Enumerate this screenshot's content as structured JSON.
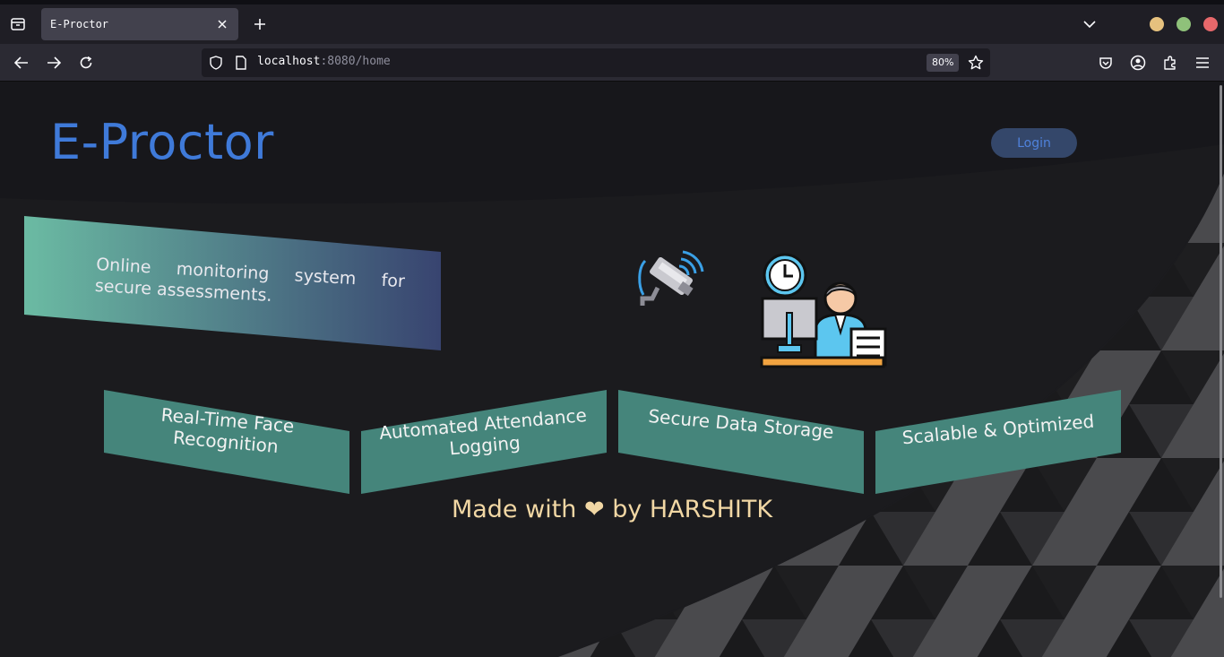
{
  "browser": {
    "tab_title": "E-Proctor",
    "url_host": "localhost",
    "url_rest": ":8080/home",
    "zoom": "80%"
  },
  "page": {
    "brand": "E-Proctor",
    "login_label": "Login",
    "tagline": "Online monitoring system for secure assessments.",
    "features": [
      {
        "label": "Real-Time Face Recognition"
      },
      {
        "label": "Automated Attendance Logging"
      },
      {
        "label": "Secure Data Storage"
      },
      {
        "label": "Scalable & Optimized"
      }
    ],
    "footer": "Made with ❤ by HARSHITK"
  },
  "colors": {
    "brand": "#3f7ad9",
    "feature_teal": "#45857b",
    "footer": "#f1d7a4",
    "login_bg": "#34476a"
  },
  "icons": [
    "cctv-camera-icon",
    "online-proctor-icon"
  ]
}
